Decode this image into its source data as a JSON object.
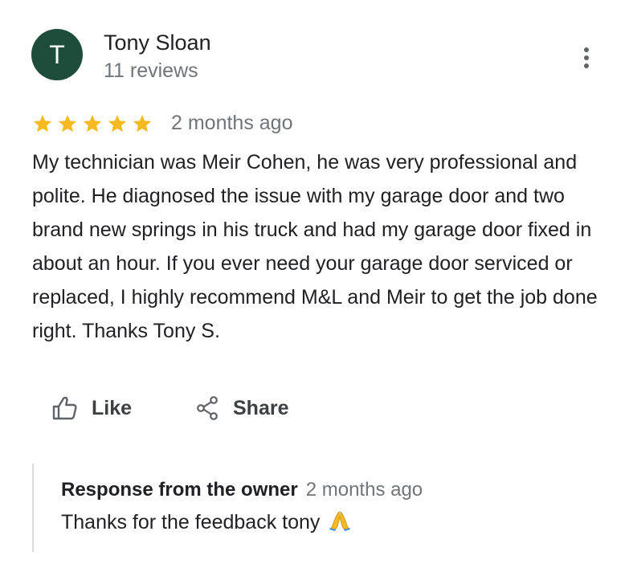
{
  "review": {
    "author": {
      "initial": "T",
      "name": "Tony Sloan",
      "reviews": "11 reviews"
    },
    "rating": 5,
    "date": "2 months ago",
    "text": "My technician was Meir Cohen, he was very professional and polite. He diagnosed the issue with my garage door and two brand new springs in his truck and had my garage door fixed in about an hour. If you ever need your garage door serviced or replaced, I highly recommend M&L and Meir to get the job done right. Thanks Tony S.",
    "actions": {
      "like_label": "Like",
      "share_label": "Share"
    },
    "owner_response": {
      "title": "Response from the owner",
      "date": "2 months ago",
      "text": "Thanks for the feedback tony",
      "emoji_icon": "folded-hands-icon"
    }
  },
  "colors": {
    "avatar_bg": "#1e4d3c",
    "star": "#f5b921",
    "secondary_text": "#70757a",
    "divider": "#dadce0"
  },
  "icons": {
    "more": "more-vert-icon",
    "like": "thumb-up-icon",
    "share": "share-icon",
    "star": "star-icon"
  }
}
